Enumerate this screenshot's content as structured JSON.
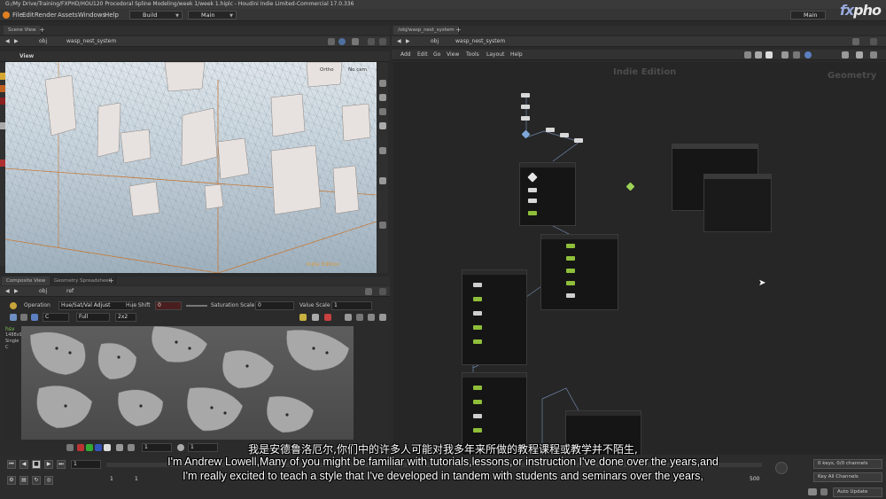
{
  "window": {
    "title": "G:/My Drive/Training/FXPHD/HOU120 Procedoral Spline Modeling/week 1/week 1.hiplc - Houdini Indie Limited-Commercial 17.0.336"
  },
  "menu": {
    "items": [
      "File",
      "Edit",
      "Render",
      "Assets",
      "Windows",
      "Help"
    ],
    "desktop": "Build",
    "main": "Main"
  },
  "watermark": {
    "text_a": "fx",
    "text_b": "pho"
  },
  "scene_view": {
    "tab": "Scene View",
    "path_root": "obj",
    "path_node": "wasp_nest_system",
    "view_label": "View",
    "persp": "Ortho",
    "cam": "No cam",
    "corner_label": "Indie Edition"
  },
  "network_view": {
    "tab": "/obj/wasp_nest_system",
    "path_root": "obj",
    "path_node": "wasp_nest_system",
    "menu": [
      "Add",
      "Edit",
      "Go",
      "View",
      "Tools",
      "Layout",
      "Help"
    ],
    "watermark": "Indie Edition",
    "context": "Geometry"
  },
  "composite": {
    "tabs": [
      "Composite View",
      "Geometry Spreadsheet"
    ],
    "path_root": "obj",
    "path_node": "ref",
    "operation_label": "Operation",
    "operation_value": "Hue/Sat/Val Adjust",
    "hue_label": "Hue Shift",
    "hue_value": "0",
    "sat_label": "Saturation Scale",
    "sat_value": "0",
    "val_label": "Value Scale",
    "val_value": "1",
    "channel": "C",
    "depth": "Full",
    "zoom": "2x2",
    "info": [
      "hsv",
      "1488x90",
      "Single",
      "C"
    ],
    "frame_value": "1"
  },
  "timeline": {
    "frame": "1",
    "start": "1",
    "end": "1",
    "end_frame": "500",
    "keys": "0 keys, 0/0 channels",
    "channels": "Key All Channels",
    "auto_update": "Auto Update"
  },
  "subtitles": {
    "cn": "我是安德鲁洛厄尔,你们中的许多人可能对我多年来所做的教程课程或教学并不陌生,",
    "en1": "I'm Andrew Lowell,Many of you might be familiar with tutorials,lessons,or instruction I've done over the years,and",
    "en2": "I'm really excited to teach a style that I've developed in tandem with students and seminars over the years,"
  }
}
